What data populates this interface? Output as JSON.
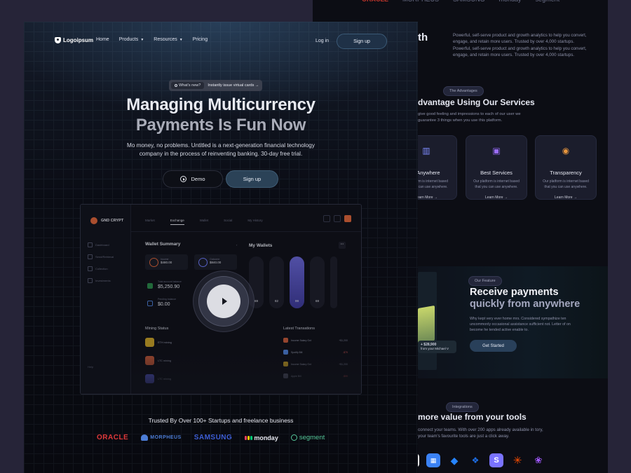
{
  "colors": {
    "accent": "#2b4257",
    "brand_orange": "#e0663a",
    "active_pillar": "#6a68d8",
    "oracle": "#e0383a",
    "samsung": "#3d5ed6",
    "segment": "#55c89a"
  },
  "background_page": {
    "heading_fragment": "th",
    "intro": "Powerful, self-serve product and growth analytics to help you convert, engage, and retain more users. Trusted by over 4,000 startups. Powerful, self-serve product and growth analytics to help you convert, engage, and retain more users. Trusted by over 4,000 startups.",
    "advantages_pill": "The Advantages",
    "advantages_title": "dvantage Using Our Services",
    "advantages_text": "give good feeling and impressions to each of our user we guarantee 3 things when you use this platform.",
    "services": [
      {
        "icon": "building-icon",
        "title": "d Anywhere",
        "text": "ur platform is internet based that you can use anywhere.",
        "link": "Learn More →"
      },
      {
        "icon": "tv-icon",
        "title": "Best Services",
        "text": "Our platform is internet based that you can use anywhere.",
        "link": "Learn More →"
      },
      {
        "icon": "eye-icon",
        "title": "Transparency",
        "text": "Our platform is internet based that you can use anywhere.",
        "link": "Learn More →"
      }
    ],
    "feature_pill": "Our Feature",
    "feature_title_1": "Receive payments",
    "feature_title_2": "quickly from anywhere",
    "feature_text": "Why kept very ever home mrs. Considered sympathize ten uncommonly occasional assistance sufficient not. Letter of on become he tended active enable to.",
    "feature_button": "Get Started",
    "bubble_amount": "+ $28,900",
    "bubble_from": "from your Michael V",
    "integrations_pill": "Integrations",
    "integrations_title": "more value from your tools",
    "integrations_text": "connect your teams. With over 200 apps already available in tory, your team's favourite tools are just a click away."
  },
  "nav": {
    "logo": "Logoipsum",
    "links": [
      "Home",
      "Products",
      "Resources",
      "Pricing"
    ],
    "login": "Log in",
    "signup": "Sign up"
  },
  "announcement": {
    "tag": "What's new?",
    "text": "Instantly issue virtual cards →"
  },
  "hero": {
    "title_line1": "Managing Multicurrency",
    "title_line2": "Payments Is Fun Now",
    "subtitle": "Mo money, no problems. Untitled is a next-generation financial technology company in the process of reinventing banking. 30-day free trial.",
    "demo_button": "Demo",
    "signup_button": "Sign up"
  },
  "dashboard": {
    "brand": "GND CRYPT",
    "sidebar": [
      "Dashboard",
      "Send/Retrieval",
      "Collection",
      "Investments"
    ],
    "sidebar_footer": "Help",
    "tabs": [
      "Market",
      "Exchange",
      "Wallet",
      "Social",
      "My History"
    ],
    "wallet_summary": "Wallet Summary",
    "income_label": "Income",
    "income_value": "$480.00",
    "outcome_label": "Outcome",
    "outcome_value": "$840.00",
    "total_label": "Total account balance",
    "total_value": "$5,250.90",
    "pending_label": "Pending balance",
    "pending_value": "$0.00",
    "my_wallets": "My Wallets",
    "wallet_values": [
      "69",
      "82",
      "99",
      "69"
    ],
    "mining_status": "Mining Status",
    "mining_items": [
      {
        "label": "ETH mining",
        "color": "#c9a227"
      },
      {
        "label": "LTC mining",
        "color": "#c55a3a"
      },
      {
        "label": "LTC mining",
        "color": "#5b5fd6"
      }
    ],
    "latest_transactions": "Latest Transations",
    "transactions": [
      {
        "name": "Income Salary Oct",
        "amount": "+$1,200",
        "color": "#c55a3a",
        "negative": false
      },
      {
        "name": "Spotify Bill",
        "amount": "-$79",
        "color": "#4d7fd6",
        "negative": true
      },
      {
        "name": "Income Salary Oct",
        "amount": "+$1,200",
        "color": "#c9a227",
        "negative": false
      },
      {
        "name": "Apple Bill",
        "amount": "-$99",
        "color": "#5a5d70",
        "negative": true
      }
    ]
  },
  "trusted": {
    "heading": "Trusted By Over 100+ Startups and freelance business",
    "logos": [
      "ORACLE",
      "MORPHEUS",
      "SAMSUNG",
      "monday",
      "segment"
    ]
  }
}
